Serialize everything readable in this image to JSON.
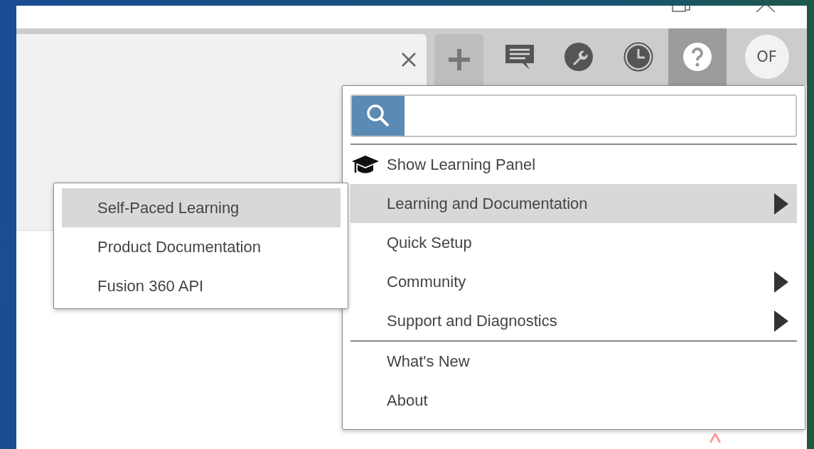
{
  "toolbar": {
    "buttons": [
      {
        "kind": "add",
        "selected": false
      },
      {
        "kind": "comments",
        "selected": false
      },
      {
        "kind": "wrench",
        "selected": false
      },
      {
        "kind": "clock",
        "selected": false
      },
      {
        "kind": "help",
        "selected": true
      }
    ],
    "avatar": "OF"
  },
  "help_menu": {
    "items": [
      {
        "kind": "icon-item",
        "label": "Show Learning Panel",
        "submenu": false,
        "selected": false
      },
      {
        "kind": "item",
        "label": "Learning and Documentation",
        "submenu": true,
        "selected": true
      },
      {
        "kind": "item",
        "label": "Quick Setup",
        "submenu": false,
        "selected": false
      },
      {
        "kind": "item",
        "label": "Community",
        "submenu": true,
        "selected": false
      },
      {
        "kind": "item",
        "label": "Support and Diagnostics",
        "submenu": true,
        "selected": false
      },
      {
        "kind": "separator"
      },
      {
        "kind": "item",
        "label": "What's New",
        "submenu": false,
        "selected": false
      },
      {
        "kind": "item",
        "label": "About",
        "submenu": false,
        "selected": false
      }
    ]
  },
  "submenu": {
    "items": [
      {
        "label": "Self-Paced Learning",
        "selected": true
      },
      {
        "label": "Product Documentation",
        "selected": false
      },
      {
        "label": "Fusion 360 API",
        "selected": false
      }
    ]
  }
}
